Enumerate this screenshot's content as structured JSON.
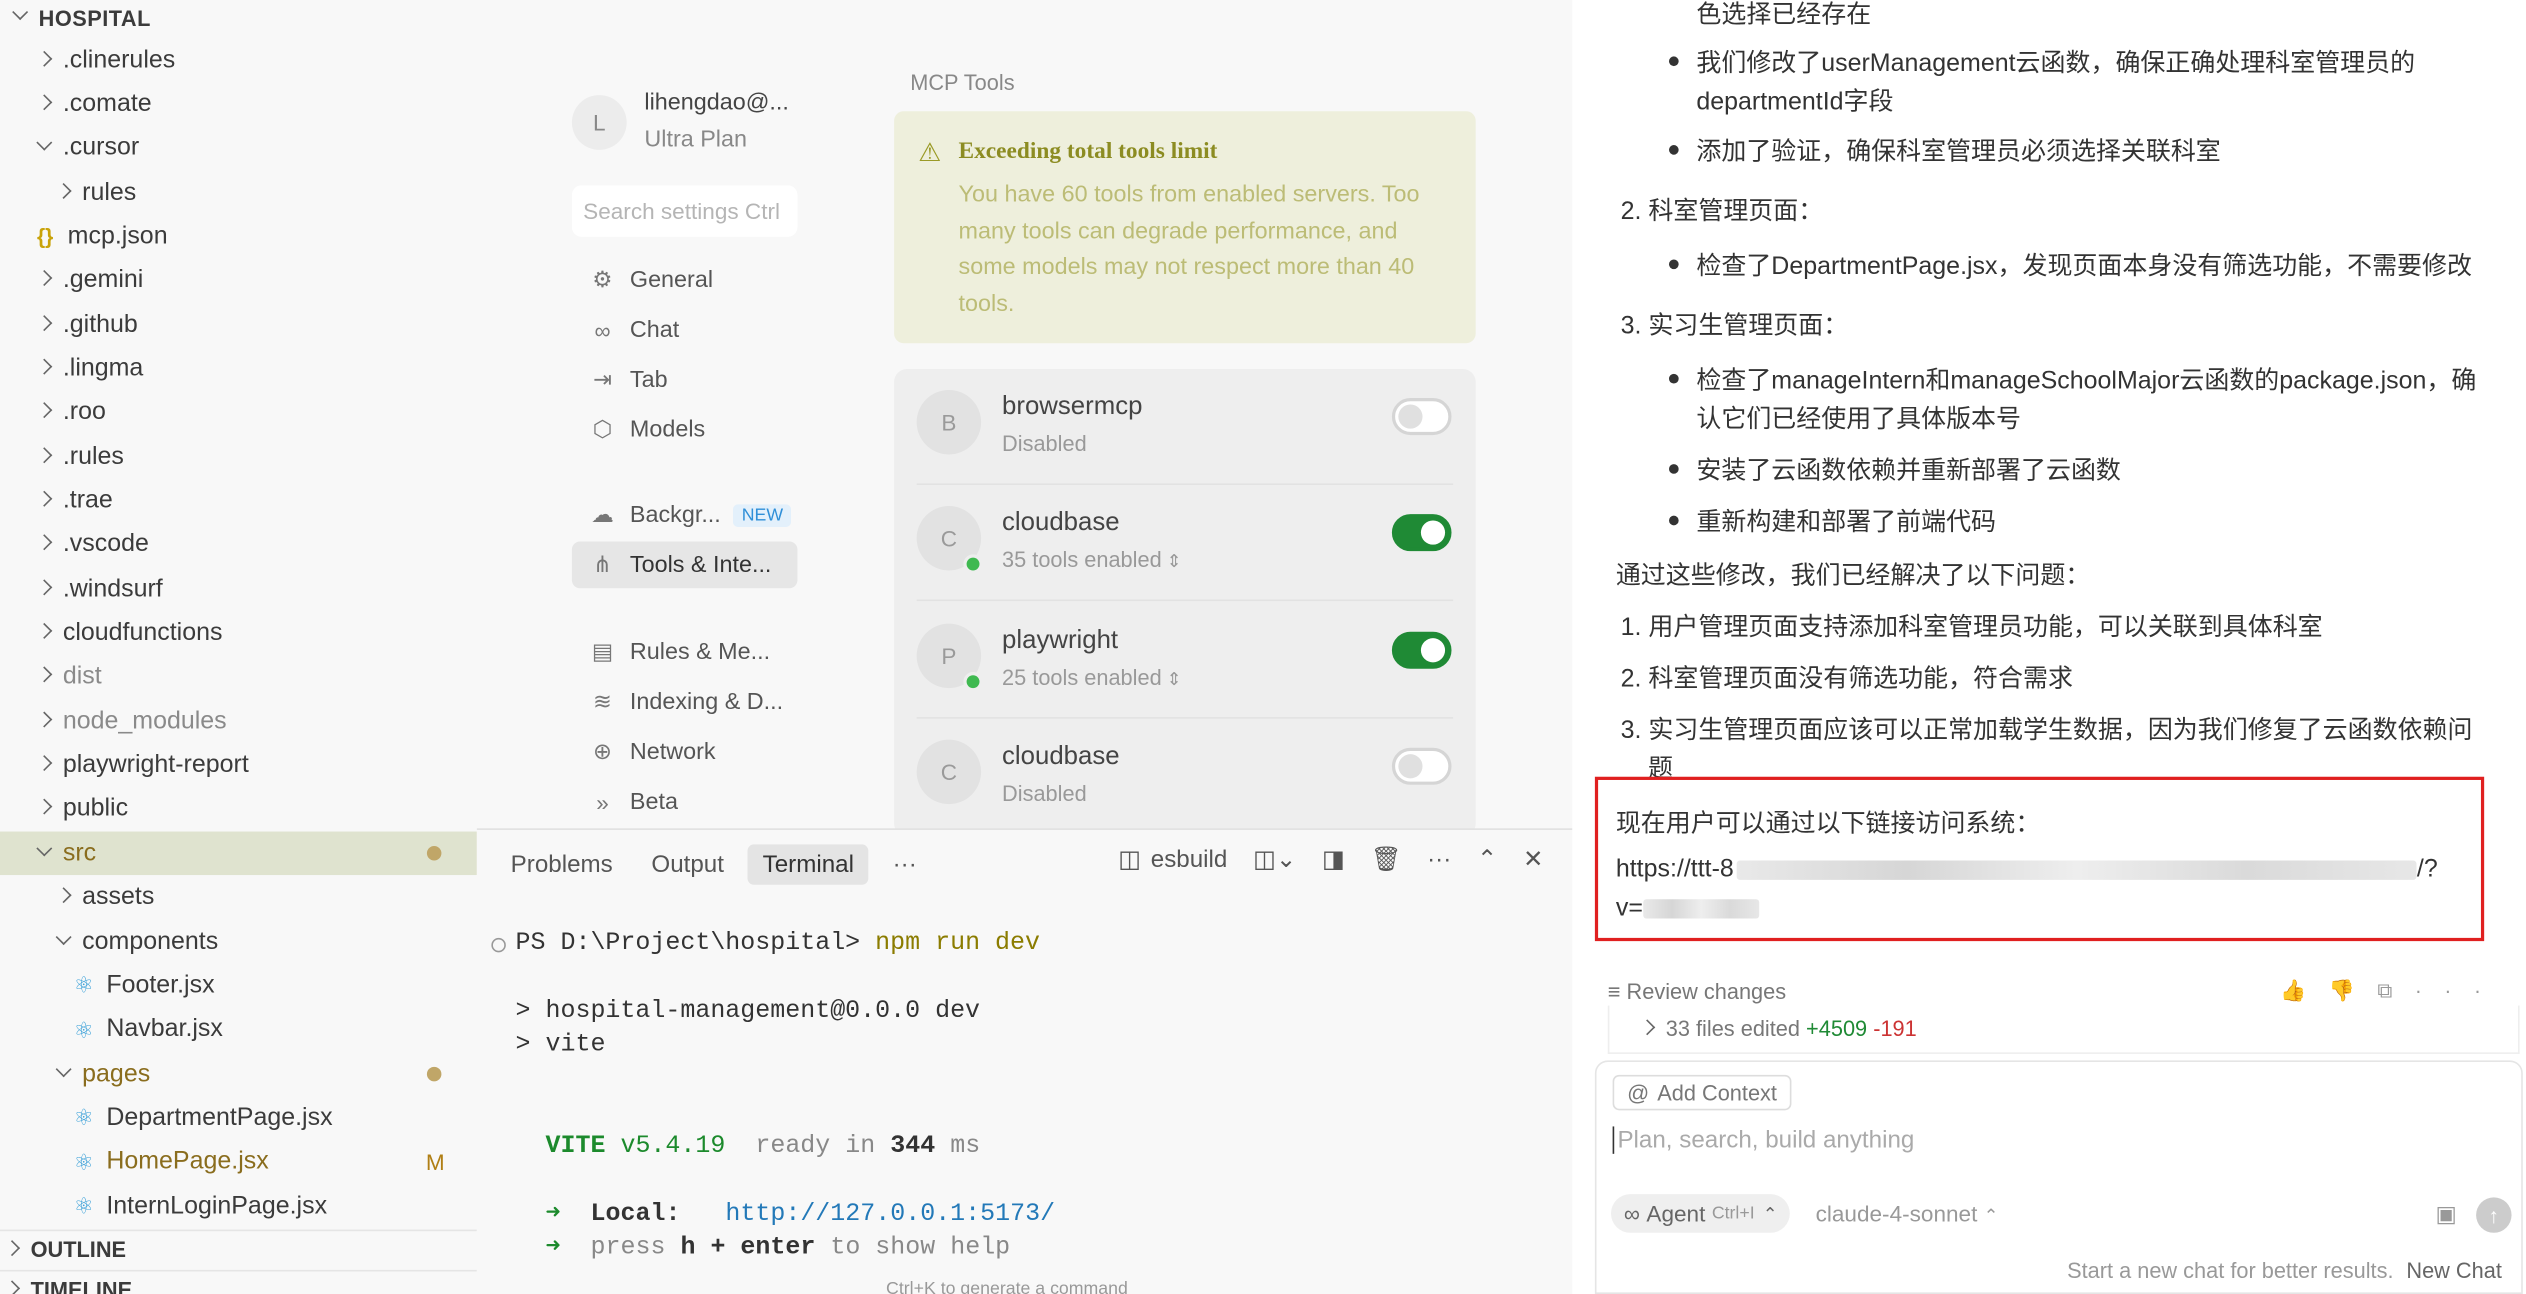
{
  "explorer": {
    "root": "HOSPITAL",
    "items": [
      {
        "label": ".clinerules",
        "icon": "chevron-right"
      },
      {
        "label": ".comate",
        "icon": "chevron-right"
      },
      {
        "label": ".cursor",
        "icon": "chevron-down"
      },
      {
        "label": "rules",
        "icon": "chevron-right"
      },
      {
        "label": "mcp.json",
        "icon": "json-file"
      },
      {
        "label": ".gemini",
        "icon": "chevron-right"
      },
      {
        "label": ".github",
        "icon": "chevron-right"
      },
      {
        "label": ".lingma",
        "icon": "chevron-right"
      },
      {
        "label": ".roo",
        "icon": "chevron-right"
      },
      {
        "label": ".rules",
        "icon": "chevron-right"
      },
      {
        "label": ".trae",
        "icon": "chevron-right"
      },
      {
        "label": ".vscode",
        "icon": "chevron-right"
      },
      {
        "label": ".windsurf",
        "icon": "chevron-right"
      },
      {
        "label": "cloudfunctions",
        "icon": "chevron-right"
      },
      {
        "label": "dist",
        "icon": "chevron-right"
      },
      {
        "label": "node_modules",
        "icon": "chevron-right"
      },
      {
        "label": "playwright-report",
        "icon": "chevron-right"
      },
      {
        "label": "public",
        "icon": "chevron-right"
      },
      {
        "label": "src",
        "icon": "chevron-down"
      },
      {
        "label": "assets",
        "icon": "chevron-right"
      },
      {
        "label": "components",
        "icon": "chevron-down"
      },
      {
        "label": "Footer.jsx",
        "icon": "react-file"
      },
      {
        "label": "Navbar.jsx",
        "icon": "react-file"
      },
      {
        "label": "pages",
        "icon": "chevron-down"
      },
      {
        "label": "DepartmentPage.jsx",
        "icon": "react-file"
      },
      {
        "label": "HomePage.jsx",
        "icon": "react-file",
        "badge": "M"
      },
      {
        "label": "InternLoginPage.jsx",
        "icon": "react-file"
      }
    ],
    "outline": "OUTLINE",
    "timeline": "TIMELINE"
  },
  "settings": {
    "user": {
      "initial": "L",
      "name": "lihengdao@...",
      "plan": "Ultra Plan"
    },
    "search_placeholder": "Search settings Ctrl",
    "nav": [
      {
        "label": "General",
        "icon": "gear-icon"
      },
      {
        "label": "Chat",
        "icon": "infinity-icon"
      },
      {
        "label": "Tab",
        "icon": "tab-arrow-icon"
      },
      {
        "label": "Models",
        "icon": "cube-icon"
      },
      {
        "label": "Backgr...",
        "icon": "cloud-icon",
        "badge": "NEW"
      },
      {
        "label": "Tools & Inte...",
        "icon": "tools-icon"
      },
      {
        "label": "Rules & Me...",
        "icon": "clipboard-icon"
      },
      {
        "label": "Indexing & D...",
        "icon": "database-icon"
      },
      {
        "label": "Network",
        "icon": "globe-icon"
      },
      {
        "label": "Beta",
        "icon": "double-chevron-icon"
      }
    ],
    "mcp_title": "MCP Tools",
    "warning": {
      "title": "Exceeding total tools limit",
      "text": "You have 60 tools from enabled servers. Too many tools can degrade performance, and some models may not respect more than 40 tools."
    },
    "servers": [
      {
        "initial": "B",
        "name": "browsermcp",
        "status": "Disabled",
        "enabled": false
      },
      {
        "initial": "C",
        "name": "cloudbase",
        "status": "35 tools enabled",
        "enabled": true
      },
      {
        "initial": "P",
        "name": "playwright",
        "status": "25 tools enabled",
        "enabled": true
      },
      {
        "initial": "C",
        "name": "cloudbase",
        "status": "Disabled",
        "enabled": false
      }
    ]
  },
  "panel": {
    "tabs": [
      "Problems",
      "Output",
      "Terminal",
      "···"
    ],
    "terminal_name": "esbuild",
    "prompt": "PS D:\\Project\\hospital>",
    "command": "npm run dev",
    "out1": "> hospital-management@0.0.0 dev",
    "out2": "> vite",
    "vite": "VITE",
    "version": "v5.4.19",
    "ready": "ready in",
    "ms": "344",
    "ms_unit": "ms",
    "arrow": "➜",
    "local_label": "Local:",
    "local_url": "http://127.0.0.1:5173/",
    "help_pre": "press",
    "help_key": "h + enter",
    "help_post": "to show help",
    "hint": "Ctrl+K to generate a command"
  },
  "chat": {
    "l0": "色选择已经存在",
    "b1": "我们修改了userManagement云函数，确保正确处理科室管理员的",
    "b1b": "departmentId字段",
    "b2": "添加了验证，确保科室管理员必须选择关联科室",
    "n2": "2. 科室管理页面：",
    "b3": "检查了DepartmentPage.jsx，发现页面本身没有筛选功能，不需要修改",
    "n3": "3. 实习生管理页面：",
    "b4": "检查了manageIntern和manageSchoolMajor云函数的package.json，确",
    "b4b": "认它们已经使用了具体版本号",
    "b5": "安装了云函数依赖并重新部署了云函数",
    "b6": "重新构建和部署了前端代码",
    "summary": "通过这些修改，我们已经解决了以下问题：",
    "s1": "1. 用户管理页面支持添加科室管理员功能，可以关联到具体科室",
    "s2": "2. 科室管理页面没有筛选功能，符合需求",
    "s3": "3. 实习生管理页面应该可以正常加载学生数据，因为我们修复了云函数依赖问",
    "s3b": "题",
    "access": "现在用户可以通过以下链接访问系统：",
    "url_start": "https://ttt-8",
    "url_end": "/?",
    "url_v": "v=",
    "review": "Review changes",
    "files_edited": "33 files edited",
    "additions": "+4509",
    "deletions": "-191",
    "add_context": "Add Context",
    "input_placeholder": "Plan, search, build anything",
    "agent": "Agent",
    "agent_shortcut": "Ctrl+I",
    "model": "claude-4-sonnet",
    "start_new": "Start a new chat for better results.",
    "new_chat": "New Chat"
  }
}
